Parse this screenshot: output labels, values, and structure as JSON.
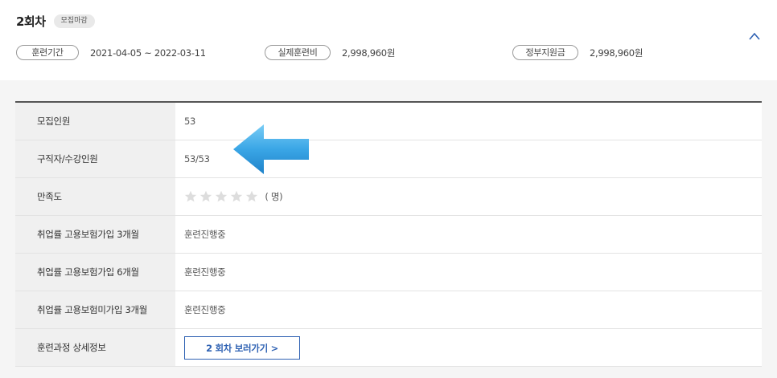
{
  "header": {
    "round_title": "2회차",
    "status_badge": "모집마감",
    "training_period_label": "훈련기간",
    "training_period_value": "2021-04-05 ~ 2022-03-11",
    "actual_fee_label": "실제훈련비",
    "actual_fee_value": "2,998,960원",
    "gov_support_label": "정부지원금",
    "gov_support_value": "2,998,960원"
  },
  "table": {
    "rows": [
      {
        "label": "모집인원",
        "value": "53"
      },
      {
        "label": "구직자/수강인원",
        "value": "53/53"
      },
      {
        "label": "만족도",
        "stars_total": 5,
        "stars_filled": 0,
        "people_text": "( 명)"
      },
      {
        "label": "취업률 고용보험가입 3개월",
        "value": "훈련진행중"
      },
      {
        "label": "취업률 고용보험가입 6개월",
        "value": "훈련진행중"
      },
      {
        "label": "취업률 고용보험미가입 3개월",
        "value": "훈련진행중"
      },
      {
        "label": "훈련과정 상세정보",
        "button_label": "2 회차 보러가기 >"
      }
    ]
  },
  "icons": {
    "collapse": "chevron-up-icon",
    "star": "star-icon",
    "pointer": "arrow-left-icon"
  },
  "colors": {
    "accent_blue": "#2f62b3",
    "arrow_blue": "#3aa6e6",
    "star_empty": "#dddddd",
    "label_bg": "#f0f0f0"
  }
}
